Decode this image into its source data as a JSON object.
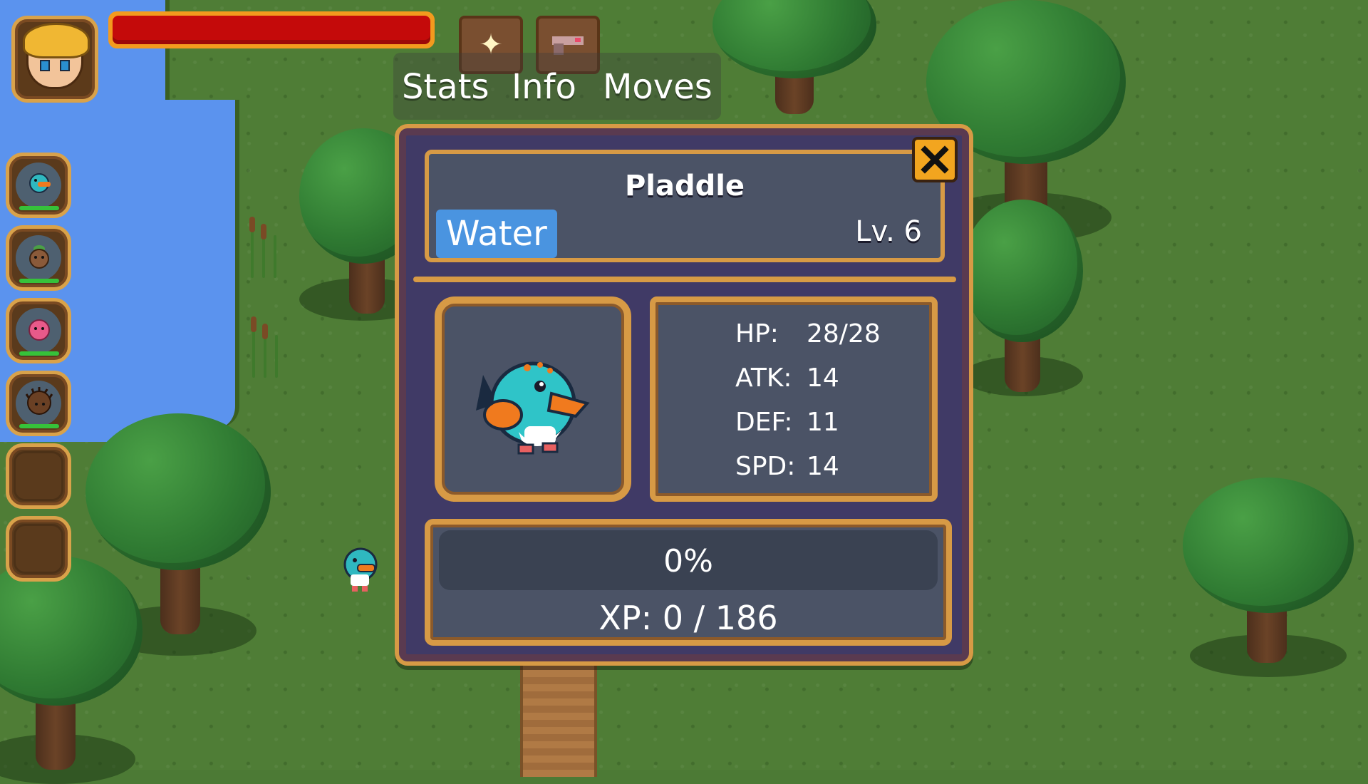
{
  "hud": {
    "player_portrait_icon": "player-portrait-icon",
    "health": {
      "fraction": 1.0,
      "color": "#c40a0a"
    },
    "slots": [
      {
        "icon": "sparkle-icon"
      },
      {
        "icon": "pistol-icon"
      }
    ]
  },
  "tabs": [
    {
      "id": "stats",
      "label": "Stats"
    },
    {
      "id": "info",
      "label": "Info"
    },
    {
      "id": "moves",
      "label": "Moves"
    }
  ],
  "party": [
    {
      "icon": "pladdle-icon",
      "hp_fraction": 1.0,
      "color": "#2fb8c0"
    },
    {
      "icon": "seedling-creature-icon",
      "hp_fraction": 1.0,
      "color": "#8a5a3a"
    },
    {
      "icon": "pink-blob-creature-icon",
      "hp_fraction": 1.0,
      "color": "#e85a8a"
    },
    {
      "icon": "hedgehog-creature-icon",
      "hp_fraction": 1.0,
      "color": "#6a4024"
    },
    {
      "icon": "empty-slot",
      "hp_fraction": null
    },
    {
      "icon": "empty-slot",
      "hp_fraction": null
    }
  ],
  "creature": {
    "name": "Pladdle",
    "type": "Water",
    "type_color": "#4a94e0",
    "level_label": "Lv. 6",
    "sprite_icon": "pladdle-sprite-icon",
    "stats": [
      {
        "key": "HP:",
        "value": "28/28"
      },
      {
        "key": "ATK:",
        "value": "14"
      },
      {
        "key": "DEF:",
        "value": "11"
      },
      {
        "key": "SPD:",
        "value": "14"
      }
    ],
    "xp": {
      "fraction": 0,
      "percent_label": "0%",
      "label": "XP: 0 / 186"
    }
  },
  "close_icon": "close-icon"
}
